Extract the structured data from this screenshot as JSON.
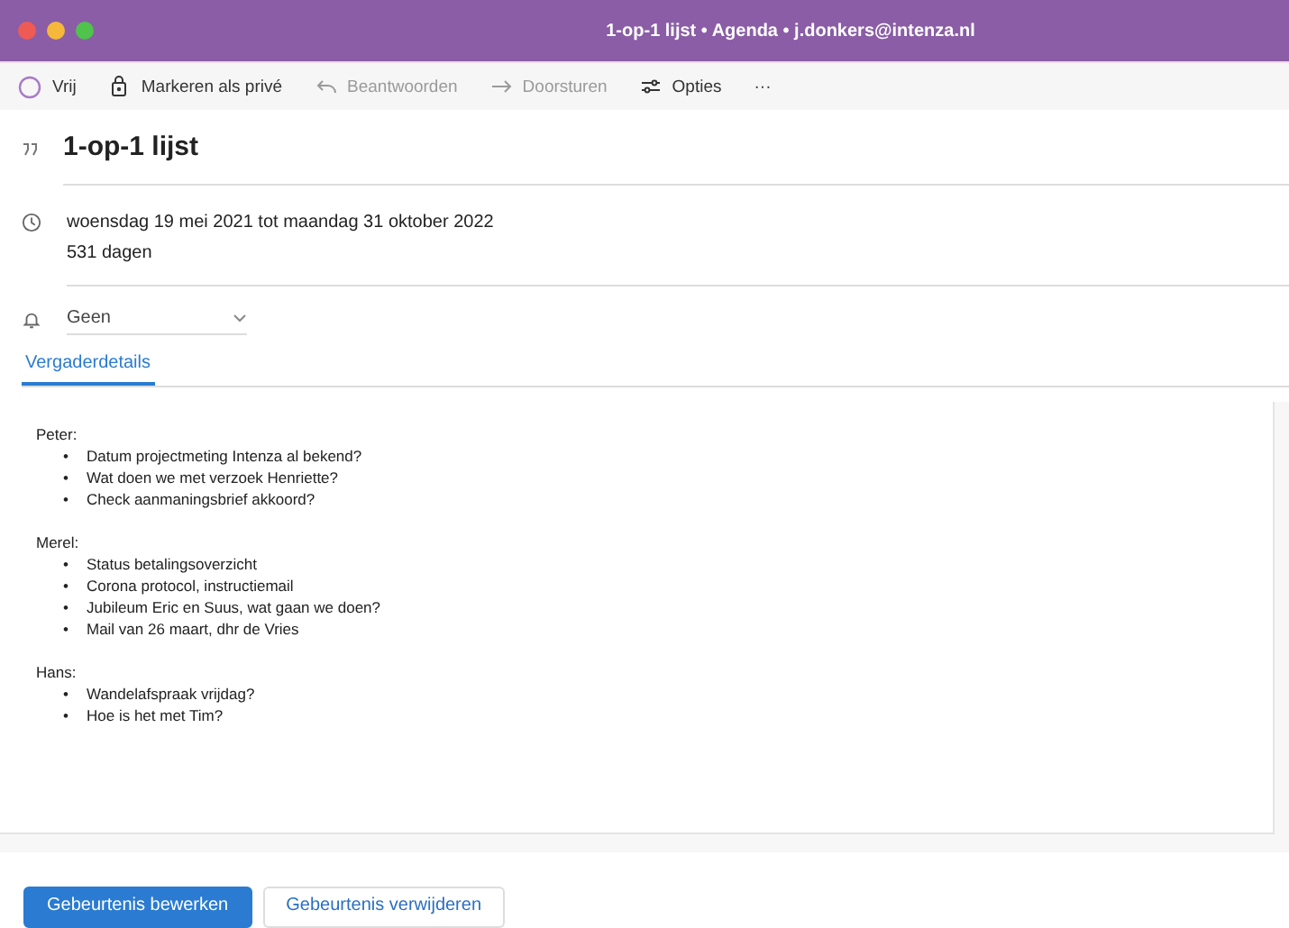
{
  "window": {
    "title": "1-op-1 lijst • Agenda • j.donkers@intenza.nl"
  },
  "toolbar": [
    {
      "kind": "status",
      "label": "Vrij",
      "disabled": false
    },
    {
      "kind": "lock",
      "label": "Markeren als privé",
      "disabled": false
    },
    {
      "kind": "reply",
      "label": "Beantwoorden",
      "disabled": true
    },
    {
      "kind": "forward",
      "label": "Doorsturen",
      "disabled": true
    },
    {
      "kind": "options",
      "label": "Opties",
      "disabled": false
    },
    {
      "kind": "more",
      "label": "···",
      "disabled": false
    }
  ],
  "event": {
    "title": "1-op-1 lijst",
    "date_range": "woensdag 19 mei 2021 tot maandag 31 oktober 2022",
    "duration": "531 dagen",
    "reminder": "Geen"
  },
  "tabs": [
    {
      "label": "Vergaderdetails",
      "selected": true
    }
  ],
  "notes": [
    {
      "name": "Peter:",
      "items": [
        {
          "bullet": "•",
          "text": "Datum projectmeting Intenza al bekend?"
        },
        {
          "bullet": "•",
          "text": "Wat doen we met verzoek Henriette?"
        },
        {
          "bullet": "•",
          "text": "Check aanmaningsbrief akkoord?"
        }
      ]
    },
    {
      "name": "Merel:",
      "items": [
        {
          "bullet": "•",
          "text": "Status betalingsoverzicht"
        },
        {
          "bullet": "•",
          "text": "Corona protocol, instructiemail"
        },
        {
          "bullet": "•",
          "text": "Jubileum Eric en Suus, wat gaan we doen?"
        },
        {
          "bullet": "•",
          "text": "Mail van 26 maart, dhr de Vries"
        }
      ]
    },
    {
      "name": "Hans:",
      "items": [
        {
          "bullet": "•",
          "text": "Wandelafspraak vrijdag?"
        },
        {
          "bullet": "•",
          "text": "Hoe is het met Tim?"
        }
      ]
    }
  ],
  "buttons": [
    {
      "label": "Gebeurtenis bewerken",
      "kind": "primary"
    },
    {
      "label": "Gebeurtenis verwijderen",
      "kind": "secondary"
    }
  ]
}
